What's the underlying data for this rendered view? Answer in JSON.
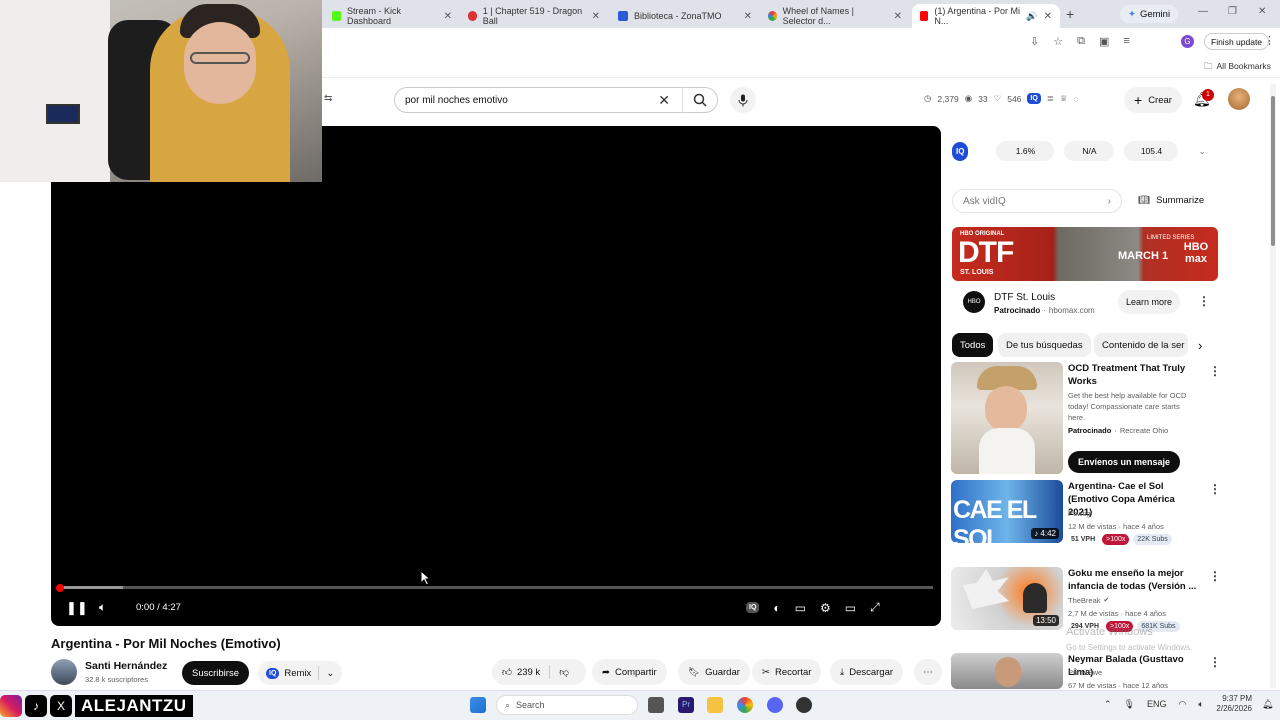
{
  "browser": {
    "tabs": [
      {
        "title": "Stream - Kick Dashboard",
        "color": "#53fc18"
      },
      {
        "title": "1 | Chapter 519 - Dragon Ball",
        "color": "#d33"
      },
      {
        "title": "Biblioteca - ZonaTMO",
        "color": "#2a5bd7"
      },
      {
        "title": "Wheel of Names | Selector d...",
        "color": "#e9a21a"
      },
      {
        "title": "(1) Argentina - Por Mi N...",
        "color": "#ff0000"
      }
    ],
    "gemini_label": "Gemini",
    "finish_update_label": "Finish update",
    "all_bookmarks_label": "All Bookmarks"
  },
  "youtube": {
    "search_value": "por mil noches emotivo",
    "stats": {
      "views": "2,379",
      "watching": "33",
      "likes": "546"
    },
    "create_label": "Crear",
    "notification_count": "1"
  },
  "video": {
    "time": "0:00 / 4:27",
    "title": "Argentina - Por Mil Noches (Emotivo)",
    "progress": 0.0,
    "buffered": 0.07
  },
  "channel": {
    "name": "Santi Hernández",
    "subscribers": "32.8 k suscriptores",
    "subscribe_label": "Suscribirse",
    "remix_label": "Remix"
  },
  "actions": {
    "likes": "239 k",
    "share": "Compartir",
    "save": "Guardar",
    "clip": "Recortar",
    "download": "Descargar"
  },
  "vidiq": {
    "badge": "IQ",
    "stats": [
      "1.6%",
      "N/A",
      "105.4"
    ],
    "ask_placeholder": "Ask vidIQ",
    "summarize_label": "Summarize"
  },
  "ad": {
    "banner_brand": "HBO ORIGINAL",
    "banner_title": "DTF",
    "banner_subtitle": "ST. LOUIS",
    "banner_right": "LIMITED SERIES",
    "banner_date": "MARCH 1",
    "banner_logo": "HBO max",
    "title": "DTF St. Louis",
    "sponsored": "Patrocinado",
    "domain": "hbomax.com",
    "cta": "Learn more"
  },
  "filters": [
    "Todos",
    "De tus búsquedas",
    "Contenido de la ser"
  ],
  "recommendations": [
    {
      "title": "OCD Treatment That Truly Works",
      "description": "Get the best help available for OCD today! Compassionate care starts here.",
      "sponsored": "Patrocinado",
      "advertiser": "Recreate Ohio",
      "cta": "Envíenos un mensaje"
    },
    {
      "title": "Argentina- Cae el Sol (Emotivo Copa América 2021)",
      "channel": "Powtig",
      "meta": "12 M de vistas · hace 4 años",
      "vph": "51 VPH",
      "badge": ">100x",
      "subs": "22K Subs",
      "duration": "4:42",
      "thumb_text": "CAE EL SOL"
    },
    {
      "title": "Goku me enseño la mejor infancia de todas (Versión ...",
      "channel": "TheBreak",
      "meta": "2,7 M de vistas · hace 4 años",
      "vph": "294 VPH",
      "badge": ">100x",
      "subs": "681K Subs",
      "duration": "13:50"
    },
    {
      "title": "Neymar Balada (Gusttavo Lima)",
      "channel": "PrimeSwe",
      "meta": "67 M de vistas · hace 12 años"
    }
  ],
  "watermark": {
    "line1": "Activate Windows",
    "line2": "Go to Settings to activate Windows."
  },
  "streamer": {
    "handle": "ALEJANTZU"
  },
  "taskbar": {
    "search_placeholder": "Search",
    "language": "ENG",
    "time": "9:37 PM",
    "date": "2/26/2026"
  }
}
